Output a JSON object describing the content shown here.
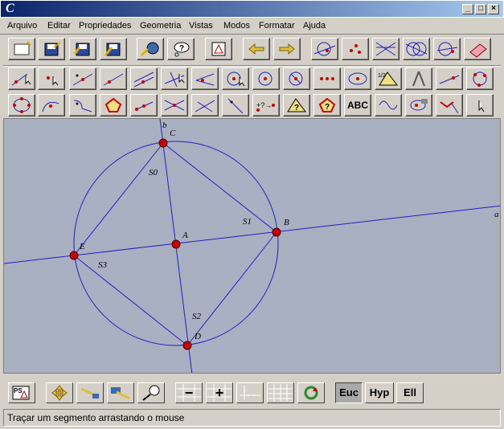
{
  "window": {
    "icon_glyph": "C",
    "minimize": "_",
    "maximize": "□",
    "close": "×"
  },
  "menu": [
    "Arquivo",
    "Editar",
    "Propriedades",
    "Geometria",
    "Vistas",
    "Modos",
    "Formatar",
    "Ajuda"
  ],
  "toolbar": {
    "row1": [
      "new-file-icon",
      "save-icon",
      "save-as-icon",
      "save-export-icon",
      "web-globe-icon",
      "help-icon",
      "construction-protocol-icon",
      "undo-arrow-icon",
      "redo-arrow-icon",
      "tangent-circle-icon",
      "points-icon",
      "lines-intersect-icon",
      "circles-intersect-icon",
      "circle-line-icon",
      "eraser-icon"
    ],
    "row2": [
      "move-point-icon",
      "point-icon",
      "point-on-line-icon",
      "line-icon",
      "parallel-line-icon",
      "perpendicular-line-icon",
      "angle-icon",
      "circle-center-icon",
      "circle-radius-icon",
      "circle-compass-icon",
      "measure-icon",
      "ellipse-icon",
      "ratio-icon",
      "compass-icon",
      "segment-measure-icon",
      "circle-three-points-icon"
    ],
    "row3": [
      "polygon-points-icon",
      "arc-icon",
      "curve-icon",
      "pentagon-icon",
      "segment-icon",
      "bisector-icon",
      "line-through-icon",
      "line-slope-icon",
      "distance-icon",
      "question-triangle-icon",
      "question-pentagon-icon",
      "text-tool-icon",
      "locus-icon",
      "animation-icon",
      "trace-icon",
      "pointer-icon"
    ],
    "text_button": "ABC"
  },
  "geometry": {
    "points": [
      {
        "name": "C"
      },
      {
        "name": "B"
      },
      {
        "name": "A"
      },
      {
        "name": "E"
      },
      {
        "name": "D"
      }
    ],
    "segments": [
      "S0",
      "S1",
      "S2",
      "S3"
    ],
    "lines": [
      "a",
      "b"
    ],
    "colors": {
      "line": "#2020c0",
      "point": "#cc0000",
      "background": "#a9b0c2"
    }
  },
  "bottombar": {
    "icons": [
      "postscript-export-icon",
      "move-canvas-icon",
      "zoom-line-icon",
      "zoom-area-icon",
      "magnify-icon",
      "zoom-out-icon",
      "zoom-in-icon",
      "axes-icon",
      "grid-icon",
      "refresh-icon"
    ],
    "zoom_out": "−",
    "zoom_in": "+",
    "geometry_modes": [
      "Euc",
      "Hyp",
      "Ell"
    ],
    "active_mode": "Euc"
  },
  "status": "Traçar um segmento arrastando o mouse"
}
